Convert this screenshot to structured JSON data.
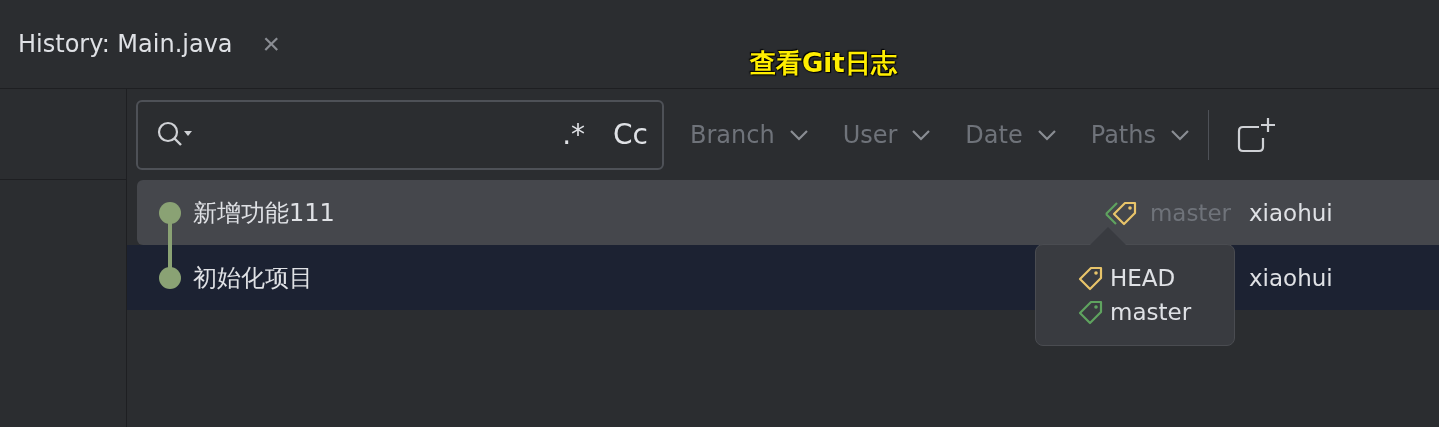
{
  "tab": {
    "title": "History: Main.java",
    "close": "×"
  },
  "annotation": "查看Git日志",
  "search": {
    "regex": ".*",
    "case": "Cc"
  },
  "filters": [
    {
      "label": "Branch"
    },
    {
      "label": "User"
    },
    {
      "label": "Date"
    },
    {
      "label": "Paths"
    }
  ],
  "commits": [
    {
      "message": "新增功能111",
      "refs": "master",
      "author": "xiaohui",
      "hovered": true,
      "selected": false
    },
    {
      "message": "初始化项目",
      "author": "xiaohui",
      "hovered": false,
      "selected": true
    }
  ],
  "tooltip": {
    "refs": [
      {
        "name": "HEAD",
        "color": "#e8c46a"
      },
      {
        "name": "master",
        "color": "#5fa35f"
      }
    ]
  }
}
